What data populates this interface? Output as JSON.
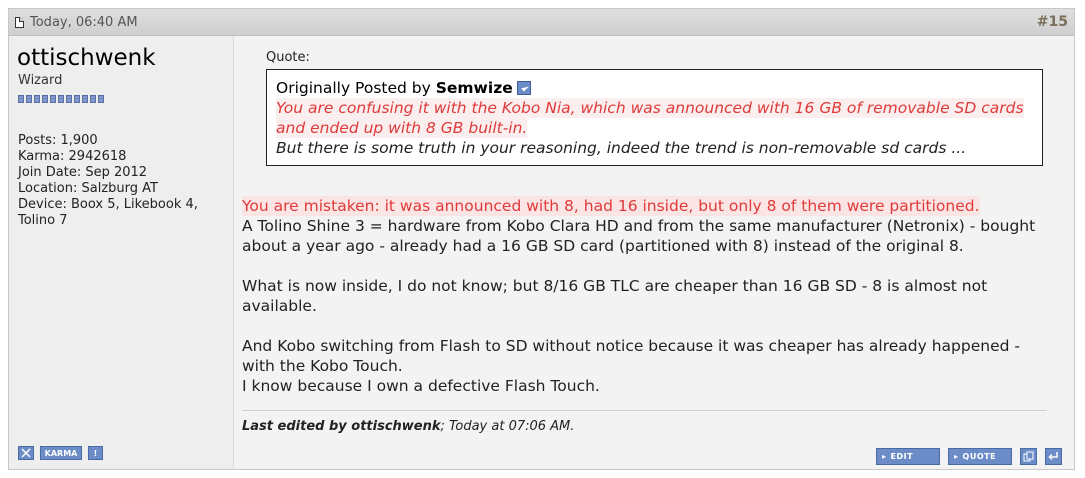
{
  "header": {
    "date": "Today, 06:40 AM",
    "post_number": "15",
    "hash": "#"
  },
  "user": {
    "name": "ottischwenk",
    "title": "Wizard",
    "rep_pips": 11,
    "stats": [
      "Posts: 1,900",
      "Karma: 2942618",
      "Join Date: Sep 2012",
      "Location: Salzburg AT",
      "Device: Boox 5, Likebook 4,",
      "Tolino 7"
    ],
    "tools": {
      "karma": "KARMA",
      "report": "!"
    }
  },
  "quote": {
    "label": "Quote:",
    "originally_posted_by": "Originally Posted by ",
    "author": "Semwize",
    "red_line_1": "You are confusing it with the Kobo Nia, which was announced with 16 GB of removable SD cards",
    "red_line_2": "and ended up with 8 GB built-in.",
    "line_3": "But there is some truth in your reasoning, indeed the trend is non-removable sd cards ..."
  },
  "message": {
    "red_line": "You are mistaken: it was announced with 8, had 16 inside, but only 8 of them were partitioned.",
    "p1_l1": "A Tolino Shine 3 = hardware from Kobo Clara HD and from the same manufacturer (Netronix) - bought",
    "p1_l2": "about a year ago - already had a 16 GB SD card (partitioned with 8) instead of the original 8.",
    "p2_l1": "What is now inside, I do not know; but 8/16 GB TLC are cheaper than 16 GB SD - 8 is almost not",
    "p2_l2": "available.",
    "p3_l1": "And Kobo switching from Flash to SD without notice because it was cheaper has already happened -",
    "p3_l2": "with the Kobo Touch.",
    "p3_l3": "I know because I own a defective Flash Touch."
  },
  "edited": {
    "prefix": "Last edited by ottischwenk",
    "suffix": "; Today at 07:06 AM."
  },
  "post_tools": {
    "edit": "EDIT",
    "quote": "QUOTE"
  },
  "colors": {
    "accent": "#6b8cc6",
    "red_text": "#e03a3a"
  }
}
